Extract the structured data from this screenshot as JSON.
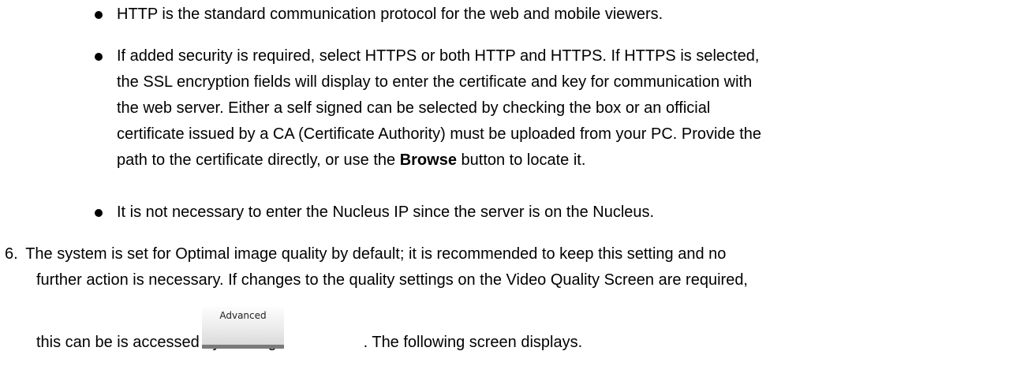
{
  "bullets": {
    "item1": "HTTP is the standard communication protocol for the web and mobile viewers.",
    "item2": {
      "line1": "If added security is required, select HTTPS or both HTTP and HTTPS. If HTTPS is selected,",
      "line2": "the SSL encryption fields will display to enter the certificate and key for communication with",
      "line3": "the web server. Either a self signed can be selected by checking the box or an official",
      "line4": "certificate issued by a CA (Certificate Authority) must be uploaded from your PC. Provide the",
      "line5_before": "path to the certificate directly, or use the ",
      "line5_bold": "Browse",
      "line5_after": " button to locate it."
    },
    "item3": "It is not necessary to enter the Nucleus IP since the server is on the Nucleus."
  },
  "step6": {
    "number": "6.",
    "line1": "The system is set for Optimal image quality by default; it is recommended to keep this setting and no",
    "line2": "further action is necessary. If changes to the quality settings on the Video Quality Screen are required,",
    "line3_before": "this can be is accessed by clicking",
    "line3_after": ". The following screen displays.",
    "button_label": "Advanced"
  }
}
